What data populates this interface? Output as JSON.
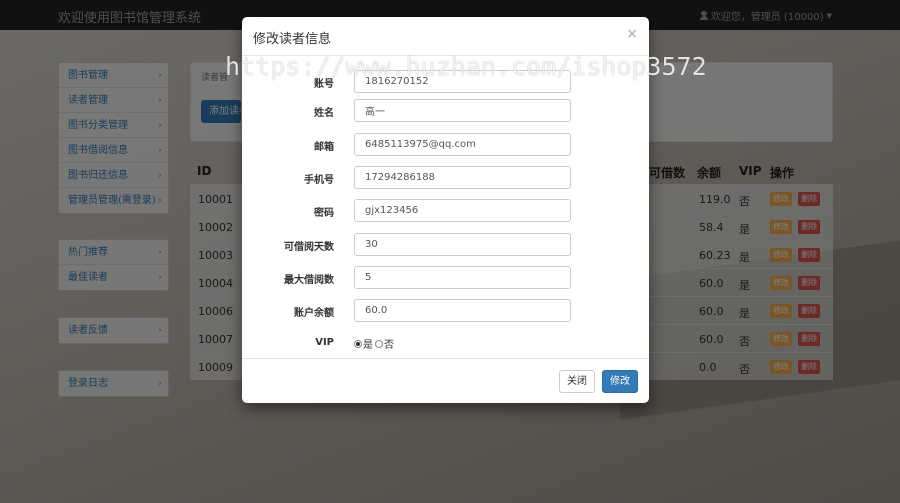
{
  "navbar": {
    "brand": "欢迎使用图书馆管理系统",
    "user": "欢迎您，管理员 (10000)"
  },
  "sidebar": {
    "group1": [
      "图书管理",
      "读者管理",
      "图书分类管理",
      "图书借阅信息",
      "图书归还信息",
      "管理员管理(需登录)"
    ],
    "group2": [
      "热门推荐",
      "最佳读者"
    ],
    "group3": [
      "读者反馈"
    ],
    "group4": [
      "登录日志"
    ]
  },
  "content": {
    "breadcrumb": "读者管",
    "add_button": "添加读者"
  },
  "table": {
    "headers": {
      "id": "ID",
      "borrow": "可借数",
      "balance": "余额",
      "vip": "VIP",
      "ops": "操作"
    },
    "rows": [
      {
        "id": "10001",
        "balance": "119.0",
        "vip": "否"
      },
      {
        "id": "10002",
        "balance": "58.4",
        "vip": "是"
      },
      {
        "id": "10003",
        "balance": "60.23",
        "vip": "是"
      },
      {
        "id": "10004",
        "balance": "60.0",
        "vip": "是"
      },
      {
        "id": "10006",
        "balance": "60.0",
        "vip": "是"
      },
      {
        "id": "10007",
        "balance": "60.0",
        "vip": "否"
      },
      {
        "id": "10009",
        "balance": "0.0",
        "vip": "否"
      }
    ],
    "edit_label": "修改",
    "delete_label": "删除"
  },
  "modal": {
    "title": "修改读者信息",
    "close_symbol": "×",
    "fields": {
      "account": {
        "label": "账号",
        "value": "1816270152"
      },
      "name": {
        "label": "姓名",
        "value": "高一"
      },
      "email": {
        "label": "邮箱",
        "value": "6485113975@qq.com"
      },
      "phone": {
        "label": "手机号",
        "value": "17294286188"
      },
      "password": {
        "label": "密码",
        "value": "gjx123456"
      },
      "borrow_days": {
        "label": "可借阅天数",
        "value": "30"
      },
      "max_borrow": {
        "label": "最大借阅数",
        "value": "5"
      },
      "balance": {
        "label": "账户余额",
        "value": "60.0"
      }
    },
    "vip": {
      "label": "VIP",
      "yes": "是",
      "no": "否",
      "selected": "是"
    },
    "close_button": "关闭",
    "submit_button": "修改"
  },
  "watermark": "https://www.huzhan.com/ishop3572"
}
